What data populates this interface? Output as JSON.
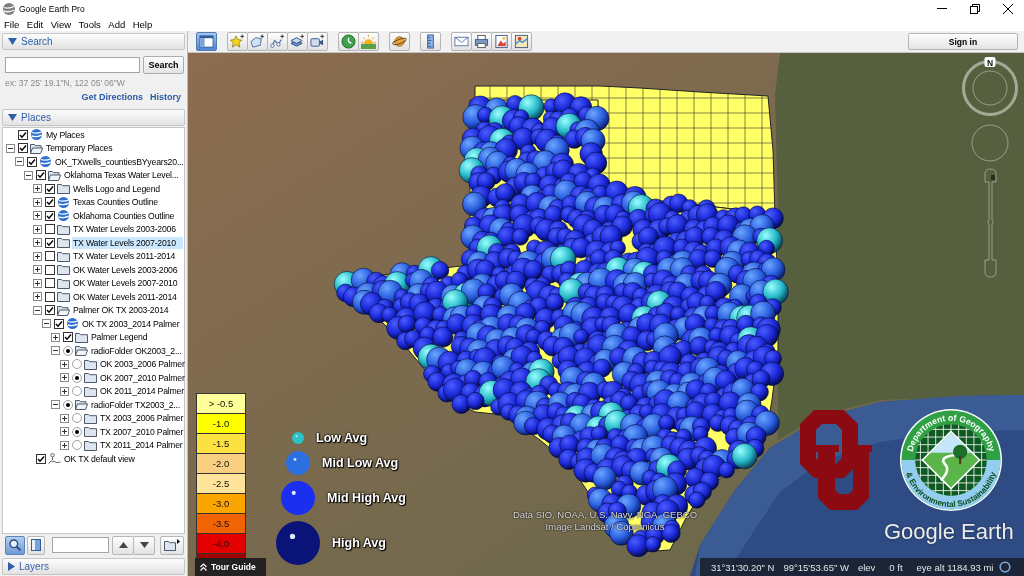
{
  "window": {
    "title": "Google Earth Pro"
  },
  "menu": [
    "File",
    "Edit",
    "View",
    "Tools",
    "Add",
    "Help"
  ],
  "toolbar": {
    "groups": [
      [
        {
          "kind": "sidebar",
          "on": true
        }
      ],
      [
        {
          "kind": "placemark",
          "on": false
        },
        {
          "kind": "polygon",
          "on": false
        },
        {
          "kind": "path",
          "on": false
        },
        {
          "kind": "overlay",
          "on": false
        },
        {
          "kind": "tour",
          "on": false
        }
      ],
      [
        {
          "kind": "history",
          "on": false
        },
        {
          "kind": "sun",
          "on": false
        }
      ],
      [
        {
          "kind": "planet",
          "on": false
        }
      ],
      [
        {
          "kind": "ruler",
          "on": false
        }
      ],
      [
        {
          "kind": "email",
          "on": false
        },
        {
          "kind": "print",
          "on": false
        },
        {
          "kind": "save",
          "on": false
        },
        {
          "kind": "maps",
          "on": false
        }
      ]
    ],
    "sign_in": "Sign in"
  },
  "search_panel": {
    "header": "Search",
    "expanded": true,
    "button": "Search",
    "hint": "ex: 37 25' 19.1\"N, 122 05' 06\"W",
    "links": [
      "Get Directions",
      "History"
    ]
  },
  "places_panel": {
    "header": "Places",
    "expanded": true,
    "tree": [
      {
        "label": "My Places",
        "kind": "link",
        "checked": true,
        "selected": false
      },
      {
        "label": "Temporary Places",
        "kind": "folder",
        "checked": true,
        "expanded": true,
        "selected": false,
        "children": [
          {
            "label": "OK_TXwells_countiesBYyears20...",
            "kind": "link",
            "checked": true,
            "expanded": true,
            "selected": false,
            "children": [
              {
                "label": "Oklahoma Texas Water Level...",
                "kind": "folder",
                "checked": true,
                "expanded": true,
                "selected": false,
                "children": [
                  {
                    "label": "Wells Logo and Legend",
                    "kind": "folder",
                    "checked": true,
                    "expanded": false,
                    "selected": false
                  },
                  {
                    "label": "Texas Counties Outline",
                    "kind": "link",
                    "checked": true,
                    "expanded": false,
                    "selected": false
                  },
                  {
                    "label": "Oklahoma Counties Outline",
                    "kind": "link",
                    "checked": true,
                    "expanded": false,
                    "selected": false
                  },
                  {
                    "label": "TX Water Levels 2003-2006",
                    "kind": "folder",
                    "checked": false,
                    "expanded": false,
                    "selected": false
                  },
                  {
                    "label": "TX Water Levels 2007-2010",
                    "kind": "folder",
                    "checked": true,
                    "expanded": false,
                    "selected": true
                  },
                  {
                    "label": "TX Water Levels 2011-2014",
                    "kind": "folder",
                    "checked": false,
                    "expanded": false,
                    "selected": false
                  },
                  {
                    "label": "OK Water Levels 2003-2006",
                    "kind": "folder",
                    "checked": false,
                    "expanded": false,
                    "selected": false
                  },
                  {
                    "label": "OK Water Levels 2007-2010",
                    "kind": "folder",
                    "checked": false,
                    "expanded": false,
                    "selected": false
                  },
                  {
                    "label": "OK Water Levels 2011-2014",
                    "kind": "folder",
                    "checked": false,
                    "expanded": false,
                    "selected": false
                  },
                  {
                    "label": "Palmer OK TX 2003-2014",
                    "kind": "folder",
                    "checked": true,
                    "expanded": true,
                    "selected": false,
                    "children": [
                      {
                        "label": "OK TX 2003_2014 Palmer",
                        "kind": "link",
                        "checked": true,
                        "expanded": true,
                        "selected": false,
                        "children": [
                          {
                            "label": "Palmer Legend",
                            "kind": "folder",
                            "checked": true,
                            "expanded": false,
                            "selected": false
                          },
                          {
                            "label": "radioFolder OK2003_2...",
                            "kind": "radio_folder",
                            "checked": true,
                            "expanded": true,
                            "selected": false,
                            "children": [
                              {
                                "label": "OK 2003_2006 Palmer",
                                "kind": "radio_folder",
                                "checked": false,
                                "expanded": false,
                                "selected": false
                              },
                              {
                                "label": "OK 2007_2010 Palmer",
                                "kind": "radio_folder",
                                "checked": true,
                                "expanded": false,
                                "selected": false
                              },
                              {
                                "label": "OK 2011_2014 Palmer",
                                "kind": "radio_folder",
                                "checked": false,
                                "expanded": false,
                                "selected": false
                              }
                            ]
                          },
                          {
                            "label": "radioFolder TX2003_2...",
                            "kind": "radio_folder",
                            "checked": true,
                            "expanded": true,
                            "selected": false,
                            "children": [
                              {
                                "label": "TX 2003_2006 Palmer",
                                "kind": "radio_folder",
                                "checked": false,
                                "expanded": false,
                                "selected": false
                              },
                              {
                                "label": "TX 2007_2010 Palmer",
                                "kind": "radio_folder",
                                "checked": true,
                                "expanded": false,
                                "selected": false
                              },
                              {
                                "label": "TX 2011_2014 Palmer",
                                "kind": "radio_folder",
                                "checked": false,
                                "expanded": false,
                                "selected": false
                              }
                            ]
                          }
                        ]
                      }
                    ]
                  }
                ]
              },
              {
                "label": "OK TX default view",
                "kind": "view",
                "checked": true,
                "selected": false
              }
            ]
          }
        ]
      }
    ]
  },
  "places_toolbar": {
    "toggles": [
      {
        "kind": "search",
        "on": true
      },
      {
        "kind": "panel",
        "on": false
      }
    ]
  },
  "layers_panel": {
    "header": "Layers",
    "expanded": false
  },
  "map": {
    "compass": "N",
    "legend_scale": [
      {
        "label": "> -0.5",
        "color": "#ffff99"
      },
      {
        "label": "-1.0",
        "color": "#ffff00"
      },
      {
        "label": "-1.5",
        "color": "#fbe241"
      },
      {
        "label": "-2.0",
        "color": "#f8cf80"
      },
      {
        "label": "-2.5",
        "color": "#fde49a"
      },
      {
        "label": "-3.0",
        "color": "#fba500"
      },
      {
        "label": "-3.5",
        "color": "#f26304"
      },
      {
        "label": "-4.0",
        "color": "#e50000"
      },
      {
        "color": "#a30000"
      }
    ],
    "wells_legend": [
      {
        "label": "Low Avg",
        "color": "#2ac2c6"
      },
      {
        "label": "Mid Low Avg",
        "color": "#2b6fe0"
      },
      {
        "label": "Mid High Avg",
        "color": "#1b2ff0"
      },
      {
        "label": "High Avg",
        "color": "#0a1478"
      }
    ],
    "attribution": [
      "Data SIO, NOAA, U.S. Navy, NGA, GEBCO",
      "Image Landsat / Copernicus"
    ],
    "seal": {
      "top_text": "Department of Geography",
      "bottom_text": "& Environmental Sustainability"
    },
    "logo_text": "Google Earth"
  },
  "status_bar": {
    "tour_guide": "Tour Guide",
    "latitude": "31°31'30.20\" N",
    "longitude": "99°15'53.65\" W",
    "elev_label": "elev",
    "elevation": "0 ft",
    "eye_alt": "eye alt 1184.93 mi"
  }
}
